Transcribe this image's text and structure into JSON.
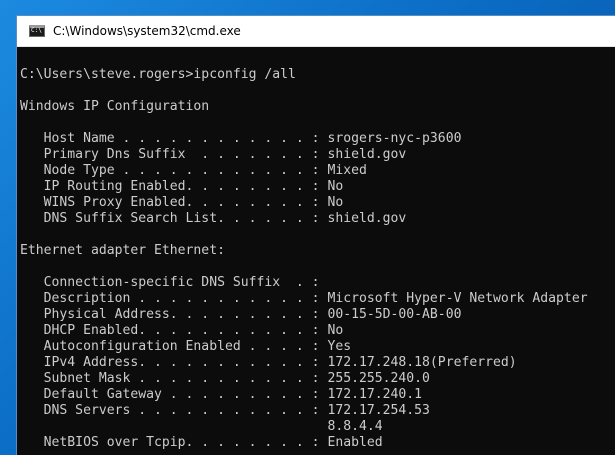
{
  "window": {
    "title": "C:\\Windows\\system32\\cmd.exe",
    "icon": "cmd-icon",
    "icon_text": "C:\\"
  },
  "console": {
    "lines": [
      "",
      "C:\\Users\\steve.rogers>ipconfig /all",
      "",
      "Windows IP Configuration",
      "",
      "   Host Name . . . . . . . . . . . . : srogers-nyc-p3600",
      "   Primary Dns Suffix  . . . . . . . : shield.gov",
      "   Node Type . . . . . . . . . . . . : Mixed",
      "   IP Routing Enabled. . . . . . . . : No",
      "   WINS Proxy Enabled. . . . . . . . : No",
      "   DNS Suffix Search List. . . . . . : shield.gov",
      "",
      "Ethernet adapter Ethernet:",
      "",
      "   Connection-specific DNS Suffix  . :",
      "   Description . . . . . . . . . . . : Microsoft Hyper-V Network Adapter",
      "   Physical Address. . . . . . . . . : 00-15-5D-00-AB-00",
      "   DHCP Enabled. . . . . . . . . . . : No",
      "   Autoconfiguration Enabled . . . . : Yes",
      "   IPv4 Address. . . . . . . . . . . : 172.17.248.18(Preferred)",
      "   Subnet Mask . . . . . . . . . . . : 255.255.240.0",
      "   Default Gateway . . . . . . . . . : 172.17.240.1",
      "   DNS Servers . . . . . . . . . . . : 172.17.254.53",
      "                                       8.8.4.4",
      "   NetBIOS over Tcpip. . . . . . . . : Enabled"
    ]
  },
  "colors": {
    "console_bg": "#0c0c0c",
    "console_fg": "#cccccc",
    "titlebar_bg": "#ffffff",
    "desktop_bg": "#0b6cc4"
  }
}
